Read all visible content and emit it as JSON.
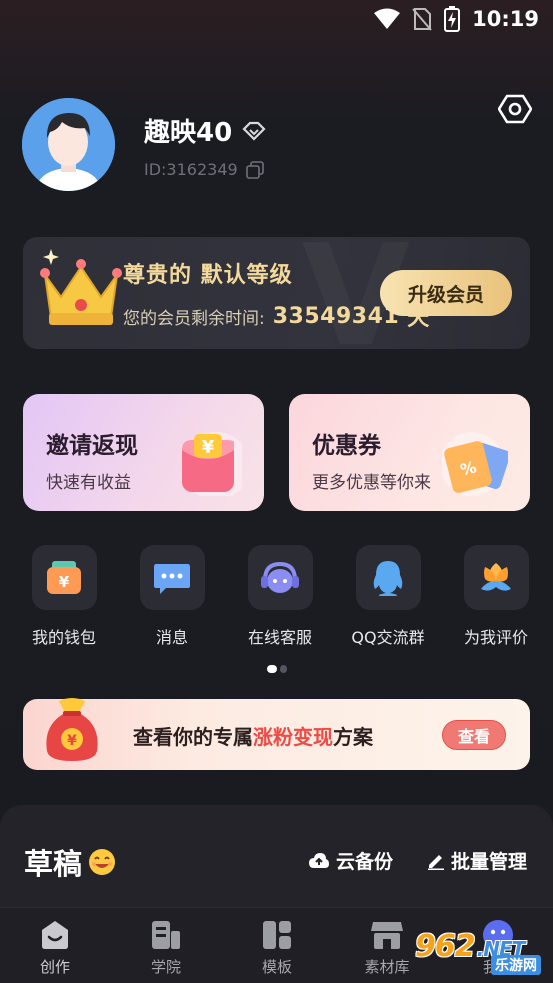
{
  "status_bar": {
    "time": "10:19"
  },
  "profile": {
    "username": "趣映40",
    "user_id": "ID:3162349",
    "avatar_color": "#5aa0ea"
  },
  "vip": {
    "title": "尊贵的 默认等级",
    "remaining_label": "您的会员剩余时间:",
    "remaining_value": "33549341",
    "remaining_unit": "天",
    "upgrade_label": "升级会员",
    "accent": "#f3d99b"
  },
  "promos": {
    "invite": {
      "title": "邀请返现",
      "subtitle": "快速有收益"
    },
    "coupon": {
      "title": "优惠券",
      "subtitle": "更多优惠等你来"
    }
  },
  "shortcuts": [
    {
      "label": "我的钱包",
      "icon": "wallet-icon"
    },
    {
      "label": "消息",
      "icon": "message-icon"
    },
    {
      "label": "在线客服",
      "icon": "headset-icon"
    },
    {
      "label": "QQ交流群",
      "icon": "qq-icon"
    },
    {
      "label": "为我评价",
      "icon": "flower-icon"
    }
  ],
  "banner": {
    "text_before": "查看你的专属",
    "text_highlight": "涨粉变现",
    "text_after": "方案",
    "button_label": "查看"
  },
  "drafts": {
    "title": "草稿",
    "cloud_backup": "云备份",
    "batch_manage": "批量管理"
  },
  "tabbar": [
    {
      "label": "创作",
      "icon": "create-icon"
    },
    {
      "label": "学院",
      "icon": "academy-icon"
    },
    {
      "label": "模板",
      "icon": "template-icon"
    },
    {
      "label": "素材库",
      "icon": "store-icon"
    },
    {
      "label": "我的",
      "icon": "profile-icon"
    }
  ],
  "watermark": {
    "logo": "962",
    "logo_suffix": ".NET",
    "sub": "乐游网"
  }
}
